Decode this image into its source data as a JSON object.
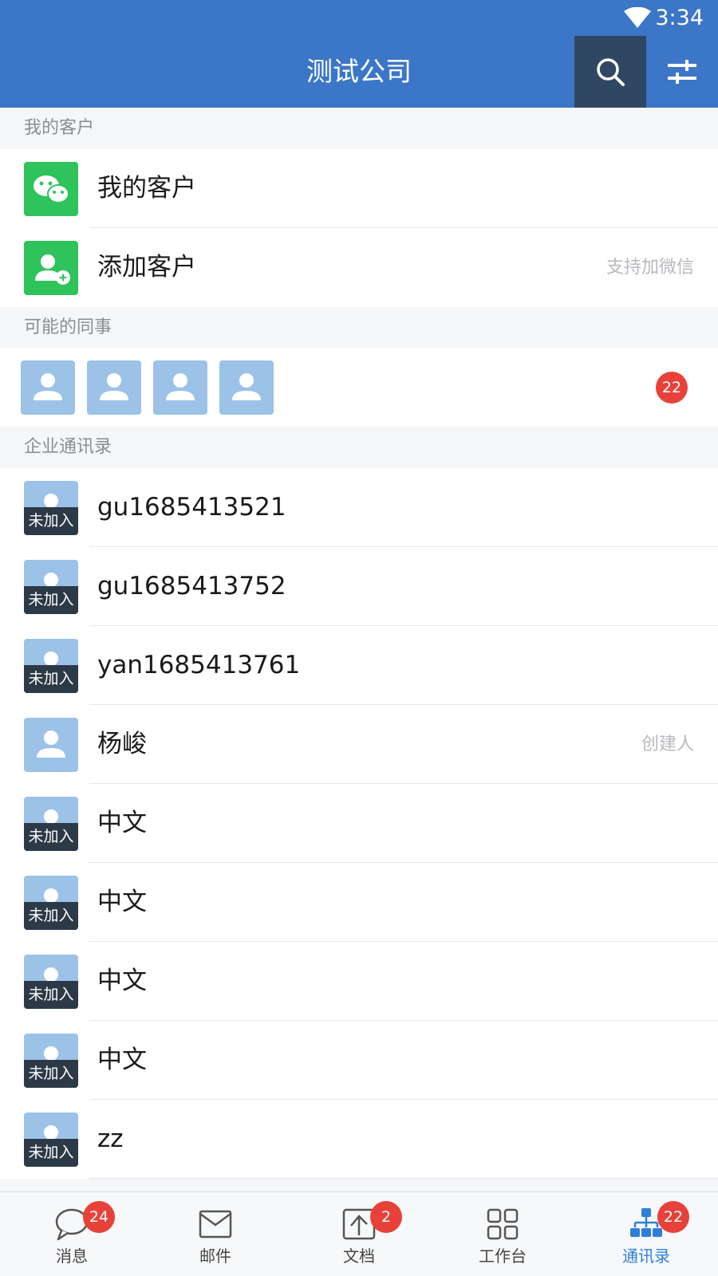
{
  "status": {
    "time": "3:34"
  },
  "header": {
    "title": "测试公司"
  },
  "sections": {
    "customers": "我的客户",
    "colleagues": "可能的同事",
    "directory": "企业通讯录"
  },
  "customer_rows": [
    {
      "label": "我的客户",
      "right": ""
    },
    {
      "label": "添加客户",
      "right": "支持加微信"
    }
  ],
  "colleagues_count": "22",
  "not_joined": "未加入",
  "contacts": [
    {
      "name": "gu1685413521",
      "tag": "未加入",
      "note": ""
    },
    {
      "name": "gu1685413752",
      "tag": "未加入",
      "note": ""
    },
    {
      "name": "yan1685413761",
      "tag": "未加入",
      "note": ""
    },
    {
      "name": "杨峻",
      "tag": "",
      "note": "创建人"
    },
    {
      "name": "中文",
      "tag": "未加入",
      "note": ""
    },
    {
      "name": "中文",
      "tag": "未加入",
      "note": ""
    },
    {
      "name": "中文",
      "tag": "未加入",
      "note": ""
    },
    {
      "name": "中文",
      "tag": "未加入",
      "note": ""
    },
    {
      "name": "zz",
      "tag": "未加入",
      "note": ""
    }
  ],
  "tabs": [
    {
      "label": "消息",
      "badge": "24",
      "icon": "chat-icon"
    },
    {
      "label": "邮件",
      "badge": "",
      "icon": "mail-icon"
    },
    {
      "label": "文档",
      "badge": "2",
      "icon": "document-icon"
    },
    {
      "label": "工作台",
      "badge": "",
      "icon": "grid-icon"
    },
    {
      "label": "通讯录",
      "badge": "22",
      "icon": "org-chart-icon",
      "active": true
    }
  ],
  "colors": {
    "header": "#3b76c7",
    "search_bg": "#2f4763",
    "badge": "#e8413a",
    "active_tab": "#2f7fd8",
    "wechat_green": "#2ec35b",
    "avatar_blue": "#9cc2e7"
  }
}
